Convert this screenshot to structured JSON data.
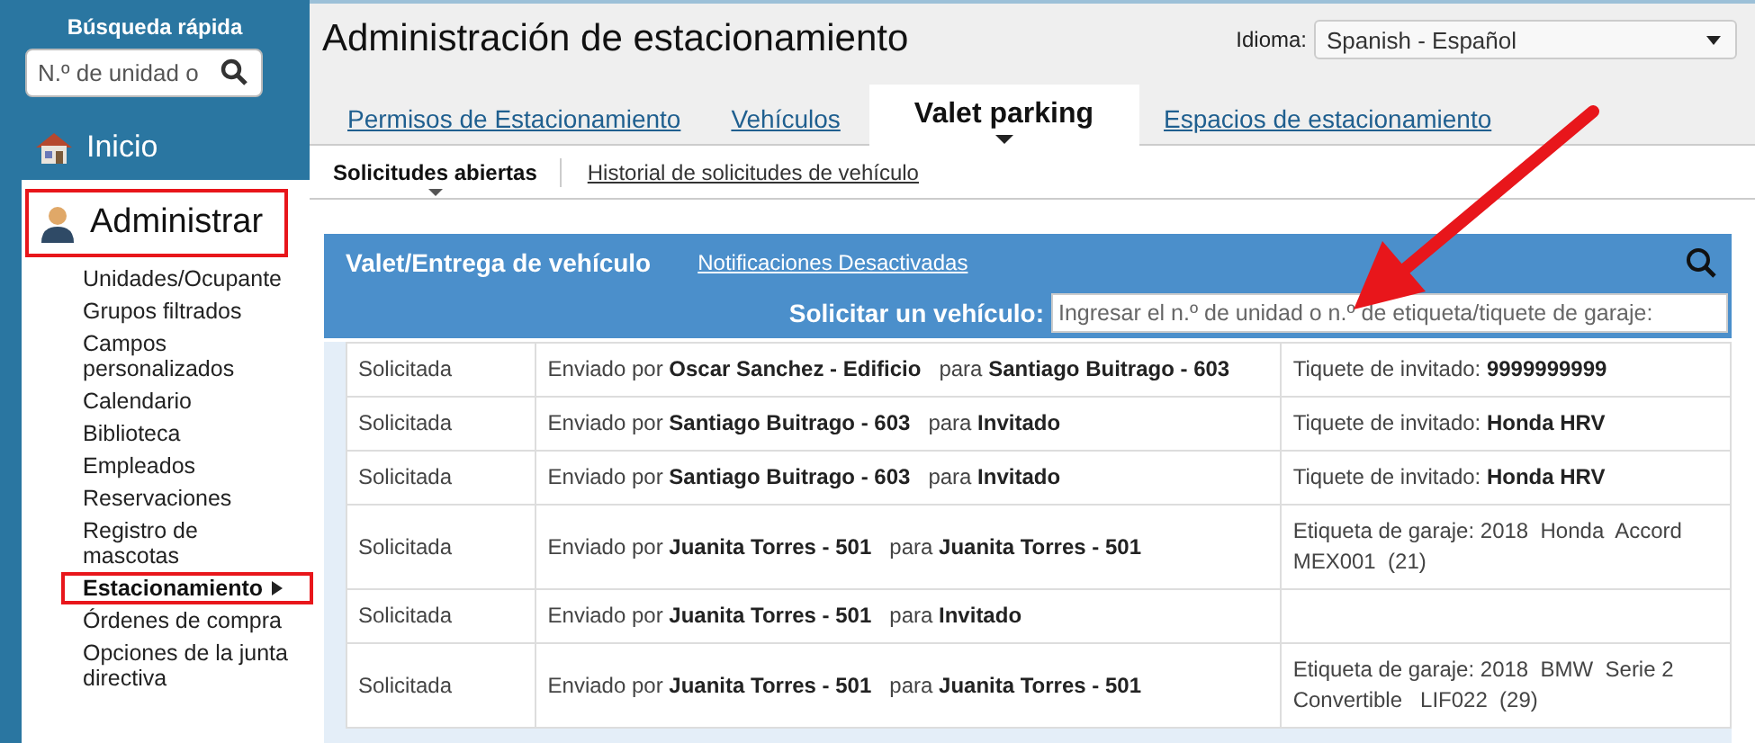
{
  "sidebar": {
    "quick_search": {
      "title": "Búsqueda rápida",
      "placeholder": "N.º de unidad o"
    },
    "home": {
      "label": "Inicio"
    },
    "section": {
      "label": "Administrar",
      "highlighted": true
    },
    "items": [
      {
        "label": "Unidades/Ocupante",
        "selected": false,
        "highlighted": false
      },
      {
        "label": "Grupos filtrados",
        "selected": false,
        "highlighted": false
      },
      {
        "label": "Campos personalizados",
        "selected": false,
        "highlighted": false
      },
      {
        "label": "Calendario",
        "selected": false,
        "highlighted": false
      },
      {
        "label": "Biblioteca",
        "selected": false,
        "highlighted": false
      },
      {
        "label": "Empleados",
        "selected": false,
        "highlighted": false
      },
      {
        "label": "Reservaciones",
        "selected": false,
        "highlighted": false
      },
      {
        "label": "Registro de mascotas",
        "selected": false,
        "highlighted": false
      },
      {
        "label": "Estacionamiento",
        "selected": true,
        "highlighted": true
      },
      {
        "label": "Órdenes de compra",
        "selected": false,
        "highlighted": false
      },
      {
        "label": "Opciones de la junta directiva",
        "selected": false,
        "highlighted": false
      }
    ]
  },
  "header": {
    "title": "Administración de estacionamiento",
    "language": {
      "label": "Idioma:",
      "value": "Spanish - Español"
    },
    "tabs": [
      {
        "label": "Permisos de Estacionamiento",
        "selected": false
      },
      {
        "label": "Vehículos",
        "selected": false
      },
      {
        "label": "Valet parking",
        "selected": true
      },
      {
        "label": "Espacios de estacionamiento",
        "selected": false
      }
    ],
    "subtabs": [
      {
        "label": "Solicitudes abiertas",
        "selected": true
      },
      {
        "label": "Historial de solicitudes de vehículo",
        "selected": false
      }
    ]
  },
  "panel": {
    "title": "Valet/Entrega de vehículo",
    "notifications_link": "Notificaciones Desactivadas",
    "request_label": "Solicitar un vehículo:",
    "request_placeholder": "Ingresar el n.º de unidad o n.º de etiqueta/tiquete de garaje:"
  },
  "table": {
    "rows": [
      {
        "status": "Solicitada",
        "sender": "Enviado por **Oscar Sanchez - Edificio**   para **Santiago Buitrago - 603**",
        "ticket": "Tiquete de invitado: **9999999999**"
      },
      {
        "status": "Solicitada",
        "sender": "Enviado por **Santiago Buitrago - 603**   para **Invitado**",
        "ticket": "Tiquete de invitado: **Honda HRV**"
      },
      {
        "status": "Solicitada",
        "sender": "Enviado por **Santiago Buitrago - 603**   para **Invitado**",
        "ticket": "Tiquete de invitado: **Honda HRV**"
      },
      {
        "status": "Solicitada",
        "sender": "Enviado por **Juanita Torres - 501**   para **Juanita Torres - 501**",
        "ticket": "Etiqueta de garaje: 2018  Honda  Accord MEX001  (21)"
      },
      {
        "status": "Solicitada",
        "sender": "Enviado por **Juanita Torres - 501**   para **Invitado**"
      },
      {
        "status": "Solicitada",
        "sender": "Enviado por **Juanita Torres - 501**   para **Juanita Torres - 501**",
        "ticket": "Etiqueta de garaje: 2018  BMW  Serie 2 Convertible   LIF022  (29)"
      }
    ]
  },
  "annotation": {
    "arrow": true
  }
}
